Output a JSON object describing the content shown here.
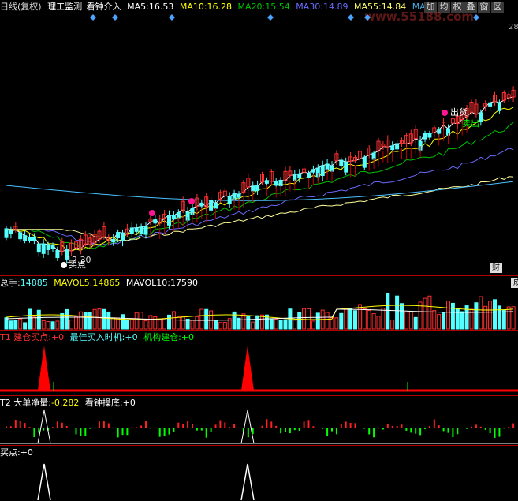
{
  "colors": {
    "ma5": "#ffffff",
    "ma10": "#ffff00",
    "ma20": "#ff00ff",
    "ma30": "#00ff00",
    "ma55": "#ffff66",
    "up": "#ff3030",
    "down": "#54ffff",
    "bar_red": "#ff0000"
  },
  "header": {
    "period": "日线(复权)",
    "indicator_name": "理工监测",
    "sub_name": "看钟介入",
    "ma5_label": "MA5:",
    "ma5_value": "16.53",
    "ma10_label": "MA10:",
    "ma10_value": "16.28",
    "ma20_label": "MA20:",
    "ma20_value": "15.54",
    "ma30_label": "MA30:",
    "ma30_value": "14.89",
    "ma55_label": "MA55:",
    "ma55_value": "14.84",
    "ma_extra_label": "MA",
    "toolbar": [
      "加",
      "均",
      "权",
      "叠",
      "窗",
      "区"
    ]
  },
  "watermark": "www.55188.com",
  "price_right": "28",
  "main_chart": {
    "low_label": "12.30",
    "buy_label": "买点",
    "sell_label": "出货",
    "sell_label2": "卖出",
    "badge_cai": "财"
  },
  "volume": {
    "title": "总手:",
    "value": "14885",
    "mavol5_label": "MAVOL5:",
    "mavol5_value": "14865",
    "mavol10_label": "MAVOL10:",
    "mavol10_value": "17590",
    "badge_cheng": "成"
  },
  "t1": {
    "title": "T1",
    "a_label": "建仓买点:",
    "a_value": "+0",
    "b_label": "最佳买入时机:",
    "b_value": "+0",
    "c_label": "机构建仓:",
    "c_value": "+0"
  },
  "t2": {
    "title": "T2",
    "a_label": "大单净量:",
    "a_value": "-0.282",
    "b_label": "看钟操底:",
    "b_value": "+0"
  },
  "t3": {
    "a_label": "买点:",
    "a_value": "+0"
  }
}
